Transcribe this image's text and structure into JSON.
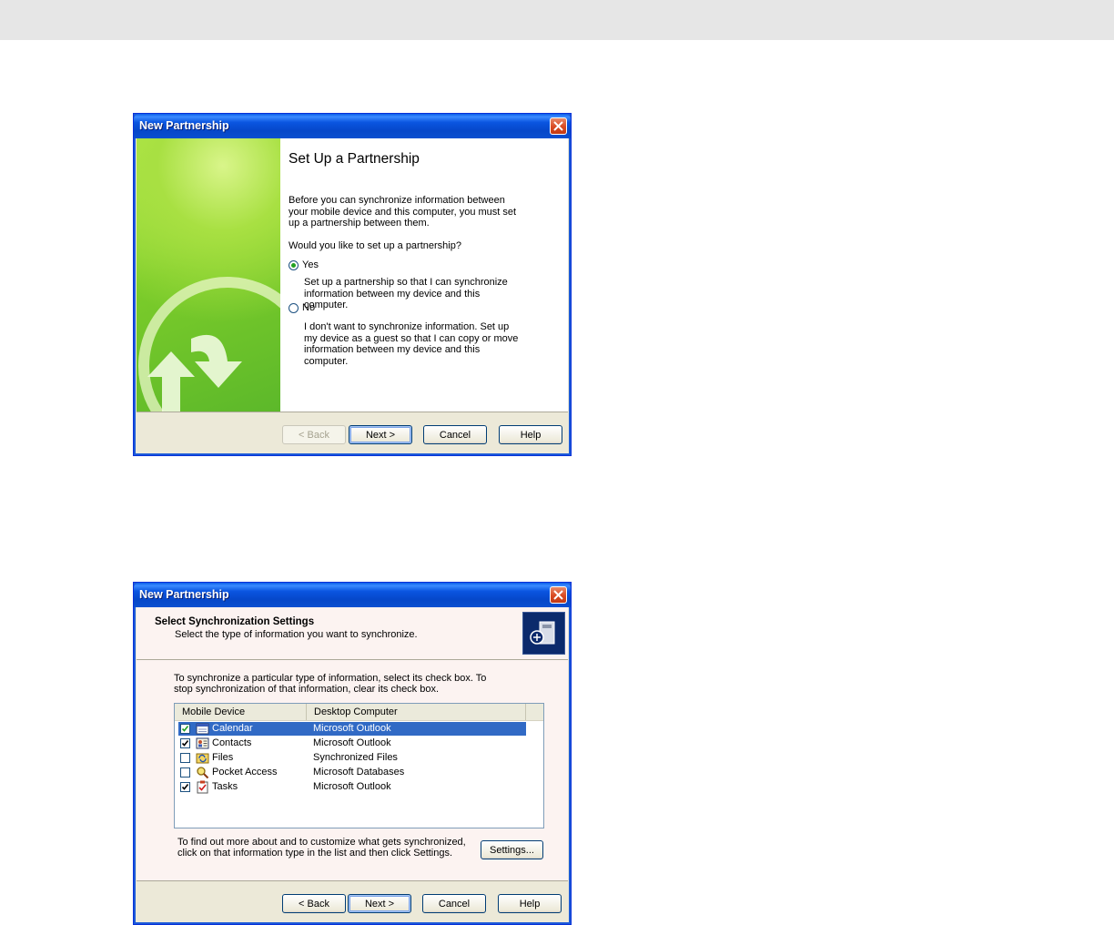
{
  "dialog1": {
    "title": "New Partnership",
    "heading": "Set Up a Partnership",
    "intro": "Before you can synchronize information between your mobile device and this computer, you must set up a partnership between them.",
    "question": "Would you like to set up a partnership?",
    "options": [
      {
        "label": "Yes",
        "checked": true,
        "description": "Set up a partnership so that I can synchronize information between my device and this computer."
      },
      {
        "label": "No",
        "checked": false,
        "description": "I don't want to synchronize information. Set up my device as a guest so that I can copy or move information between my device and this computer."
      }
    ],
    "buttons": {
      "back": "< Back",
      "next": "Next >",
      "cancel": "Cancel",
      "help": "Help"
    }
  },
  "dialog2": {
    "title": "New Partnership",
    "header_title": "Select Synchronization Settings",
    "header_subtitle": "Select the type of information you want to synchronize.",
    "instructions": "To synchronize a particular type of information, select its check box. To stop synchronization of that information, clear its check box.",
    "columns": [
      "Mobile Device",
      "Desktop Computer"
    ],
    "rows": [
      {
        "name": "Calendar",
        "desktop": "Microsoft Outlook",
        "checked": true,
        "selected": true,
        "icon": "calendar-icon"
      },
      {
        "name": "Contacts",
        "desktop": "Microsoft Outlook",
        "checked": true,
        "selected": false,
        "icon": "contacts-icon"
      },
      {
        "name": "Files",
        "desktop": "Synchronized Files",
        "checked": false,
        "selected": false,
        "icon": "files-icon"
      },
      {
        "name": "Pocket Access",
        "desktop": "Microsoft Databases",
        "checked": false,
        "selected": false,
        "icon": "pocket-access-icon"
      },
      {
        "name": "Tasks",
        "desktop": "Microsoft Outlook",
        "checked": true,
        "selected": false,
        "icon": "tasks-icon"
      }
    ],
    "more_info": "To find out more about and to customize what gets synchronized, click on that information type in the list and then click Settings.",
    "settings_button": "Settings...",
    "buttons": {
      "back": "< Back",
      "next": "Next >",
      "cancel": "Cancel",
      "help": "Help"
    }
  }
}
